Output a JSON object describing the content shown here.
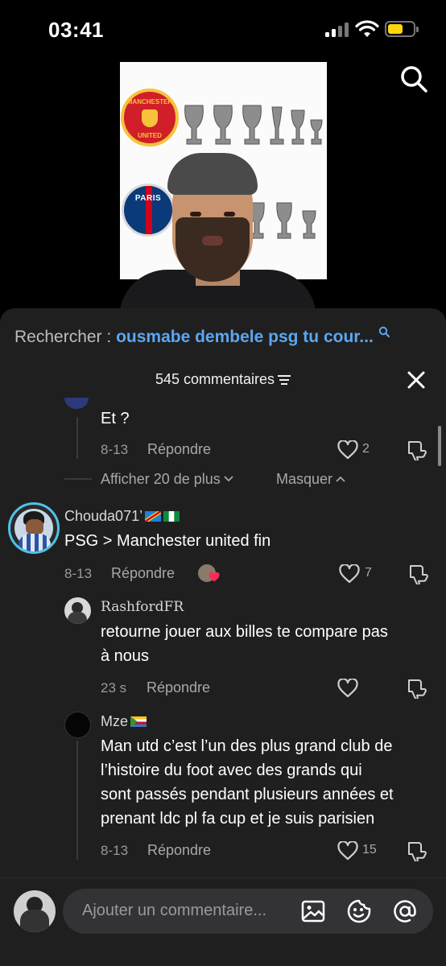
{
  "status_bar": {
    "time": "03:41",
    "battery_color": "#ffd60a"
  },
  "video": {
    "top_right_icon": "search-icon",
    "frame_text": {
      "mu_crest_top": "MANCHESTER",
      "mu_crest_bottom": "UNITED",
      "psg_crest": "PARIS"
    }
  },
  "related_search": {
    "prefix": "Rechercher : ",
    "query": "ousmabe dembele psg tu cour...",
    "query_color": "#5aa7f2"
  },
  "comments_header": {
    "count_label": "545 commentaires",
    "sort_icon": "sort-lines-icon",
    "close_icon": "close-icon"
  },
  "comments": {
    "partial_reply": {
      "text": "Et ?",
      "date": "8-13",
      "reply_label": "Répondre",
      "likes": "2"
    },
    "thread_controls": {
      "show_more": "Afficher 20 de plus",
      "hide": "Masquer"
    },
    "main_comment": {
      "username": "Chouda071’",
      "flags": [
        "flag-dr-congo",
        "flag-nigeria"
      ],
      "text": "PSG > Manchester united fin",
      "date": "8-13",
      "reply_label": "Répondre",
      "likes": "7",
      "creator_liked": true
    },
    "replies": [
      {
        "username": "RashfordFR",
        "text_line1": "retourne jouer aux billes te compare pas",
        "text_line2": "à nous",
        "date": "23 s",
        "reply_label": "Répondre",
        "likes": ""
      },
      {
        "username": "Mze",
        "flags": [
          "flag-comoros"
        ],
        "text_line1": "Man utd c’est l’un des plus grand club de",
        "text_line2": "l’histoire du foot avec des grands qui",
        "text_line3": "sont passés pendant plusieurs années et",
        "text_line4": "prenant ldc pl fa cup et je suis parisien",
        "date": "8-13",
        "reply_label": "Répondre",
        "likes": "15"
      }
    ]
  },
  "input_bar": {
    "placeholder": "Ajouter un commentaire...",
    "icons": [
      "image-icon",
      "emoji-icon",
      "mention-icon"
    ]
  }
}
